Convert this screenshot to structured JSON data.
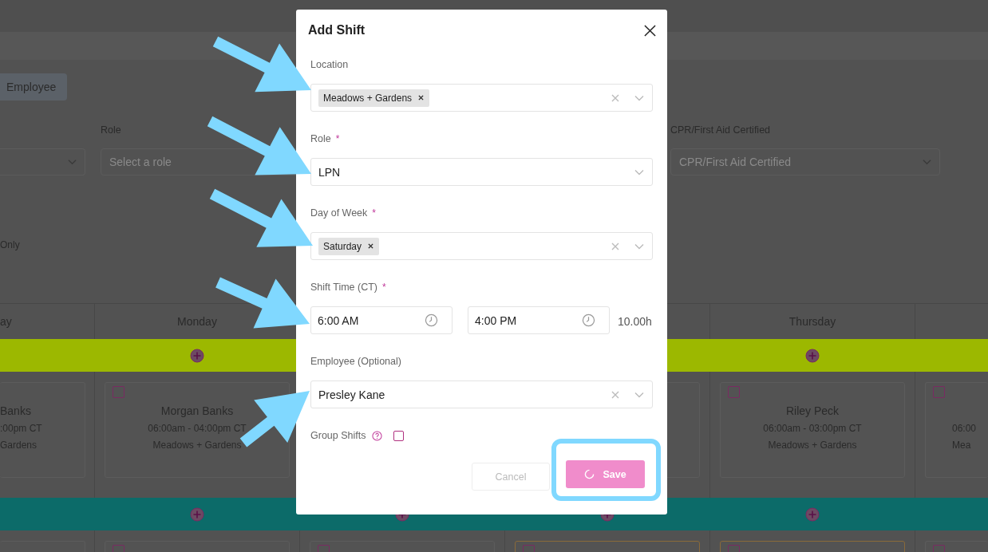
{
  "page": {
    "tabs": [
      {
        "label": "Employee",
        "selected": true
      }
    ],
    "filters": [
      {
        "kind": "partial"
      },
      {
        "kind": "select",
        "label": "Role",
        "placeholder": "Select a role"
      },
      {
        "kind": "select",
        "label": "CPR/First Aid Certified",
        "placeholder": "CPR/First Aid Certified"
      }
    ],
    "toggle_label": "Only"
  },
  "schedule": {
    "columns": [
      {
        "kind": "cutleft",
        "header": "ay"
      },
      {
        "kind": "full",
        "header": "Monday"
      },
      {
        "kind": "full"
      },
      {
        "kind": "full"
      },
      {
        "kind": "full",
        "header": "Thursday"
      },
      {
        "kind": "cutright"
      }
    ],
    "bands": [
      {
        "color": "#9cb800"
      },
      {
        "color": "#0c6b69"
      }
    ],
    "rows": [
      {
        "cards": [
          {
            "name": "Banks",
            "time": ":00pm CT",
            "location": "Gardens"
          },
          {
            "name": "Morgan Banks",
            "time": "06:00am - 04:00pm CT",
            "location": "Meadows + Gardens",
            "checked": false
          },
          {
            "kind": "hidden"
          },
          {
            "kind": "blank"
          },
          {
            "name": "Riley Peck",
            "time": "06:00am - 03:00pm CT",
            "location": "Meadows + Gardens",
            "checked": false
          },
          {
            "time": "06:00",
            "location": "Mea",
            "checked": false
          }
        ]
      },
      {
        "cards": [
          {
            "kind": "blank"
          },
          {
            "checked": false
          },
          {
            "checked": false
          },
          {
            "checked": false,
            "flagged": true
          },
          {
            "checked": false,
            "flagged": true
          },
          {
            "checked": false
          }
        ]
      }
    ]
  },
  "modal": {
    "title": "Add Shift",
    "fields": [
      {
        "kind": "multiselect",
        "label": "Location",
        "chips": [
          "Meadows + Gardens"
        ],
        "clearable": true
      },
      {
        "kind": "select",
        "label": "Role",
        "required_mark": "*",
        "value": "LPN",
        "clearable": false
      },
      {
        "kind": "multiselect",
        "label": "Day of Week",
        "required_mark": "*",
        "chips": [
          "Saturday"
        ],
        "clearable": true
      },
      {
        "kind": "timerange",
        "label": "Shift Time (CT)",
        "required_mark": "*",
        "start": "6:00 AM",
        "end": "4:00 PM",
        "duration": "10.00h"
      },
      {
        "kind": "select",
        "label": "Employee (Optional)",
        "value": "Presley Kane",
        "clearable": true
      }
    ],
    "group_shifts": {
      "label": "Group Shifts",
      "checked": false
    },
    "buttons": {
      "cancel": {
        "label": "Cancel",
        "disabled": true
      },
      "save": {
        "label": "Save",
        "loading": true
      }
    }
  }
}
